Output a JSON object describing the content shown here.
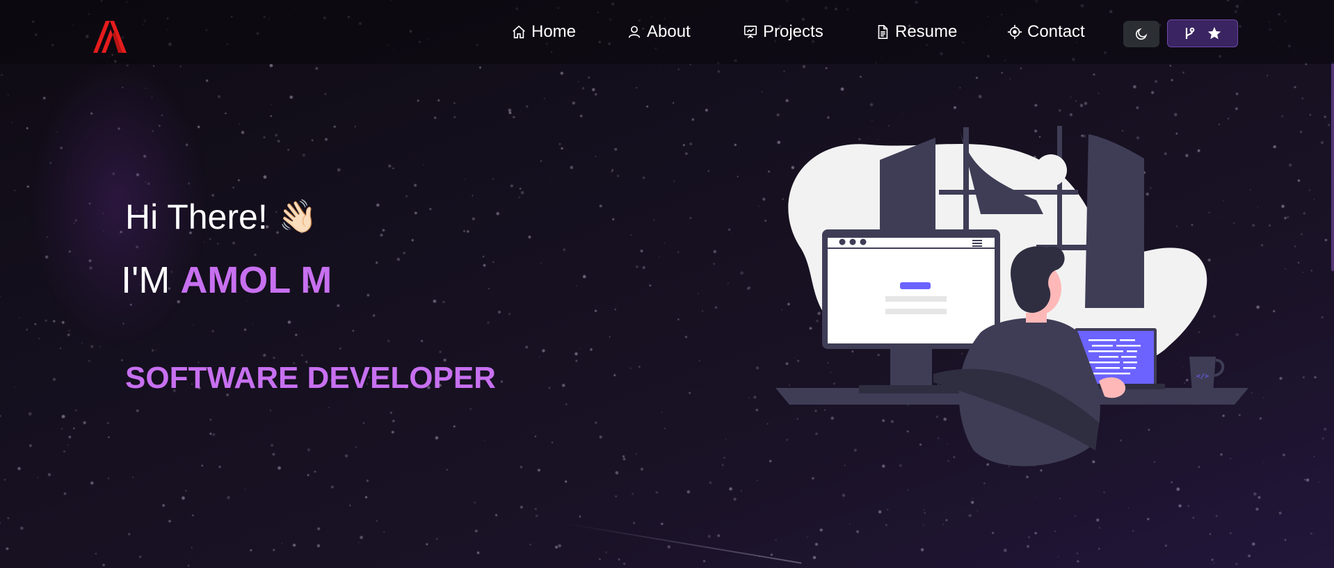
{
  "nav": {
    "items": [
      {
        "label": "Home",
        "icon": "home-icon"
      },
      {
        "label": "About",
        "icon": "user-icon"
      },
      {
        "label": "Projects",
        "icon": "presentation-icon"
      },
      {
        "label": "Resume",
        "icon": "document-icon"
      },
      {
        "label": "Contact",
        "icon": "crosshair-icon"
      }
    ],
    "theme_toggle_icon": "moon-icon",
    "github_icons": [
      "git-fork-icon",
      "star-icon"
    ],
    "logo_icon": "am-logo"
  },
  "hero": {
    "greeting": "Hi There!",
    "wave_emoji": "👋🏻",
    "im_prefix": "I'M",
    "name": "AMOL M",
    "role": "SOFTWARE DEVELOPER"
  },
  "colors": {
    "accent": "#c770f0",
    "logo_red": "#e51c1c",
    "background": "#15101f"
  }
}
